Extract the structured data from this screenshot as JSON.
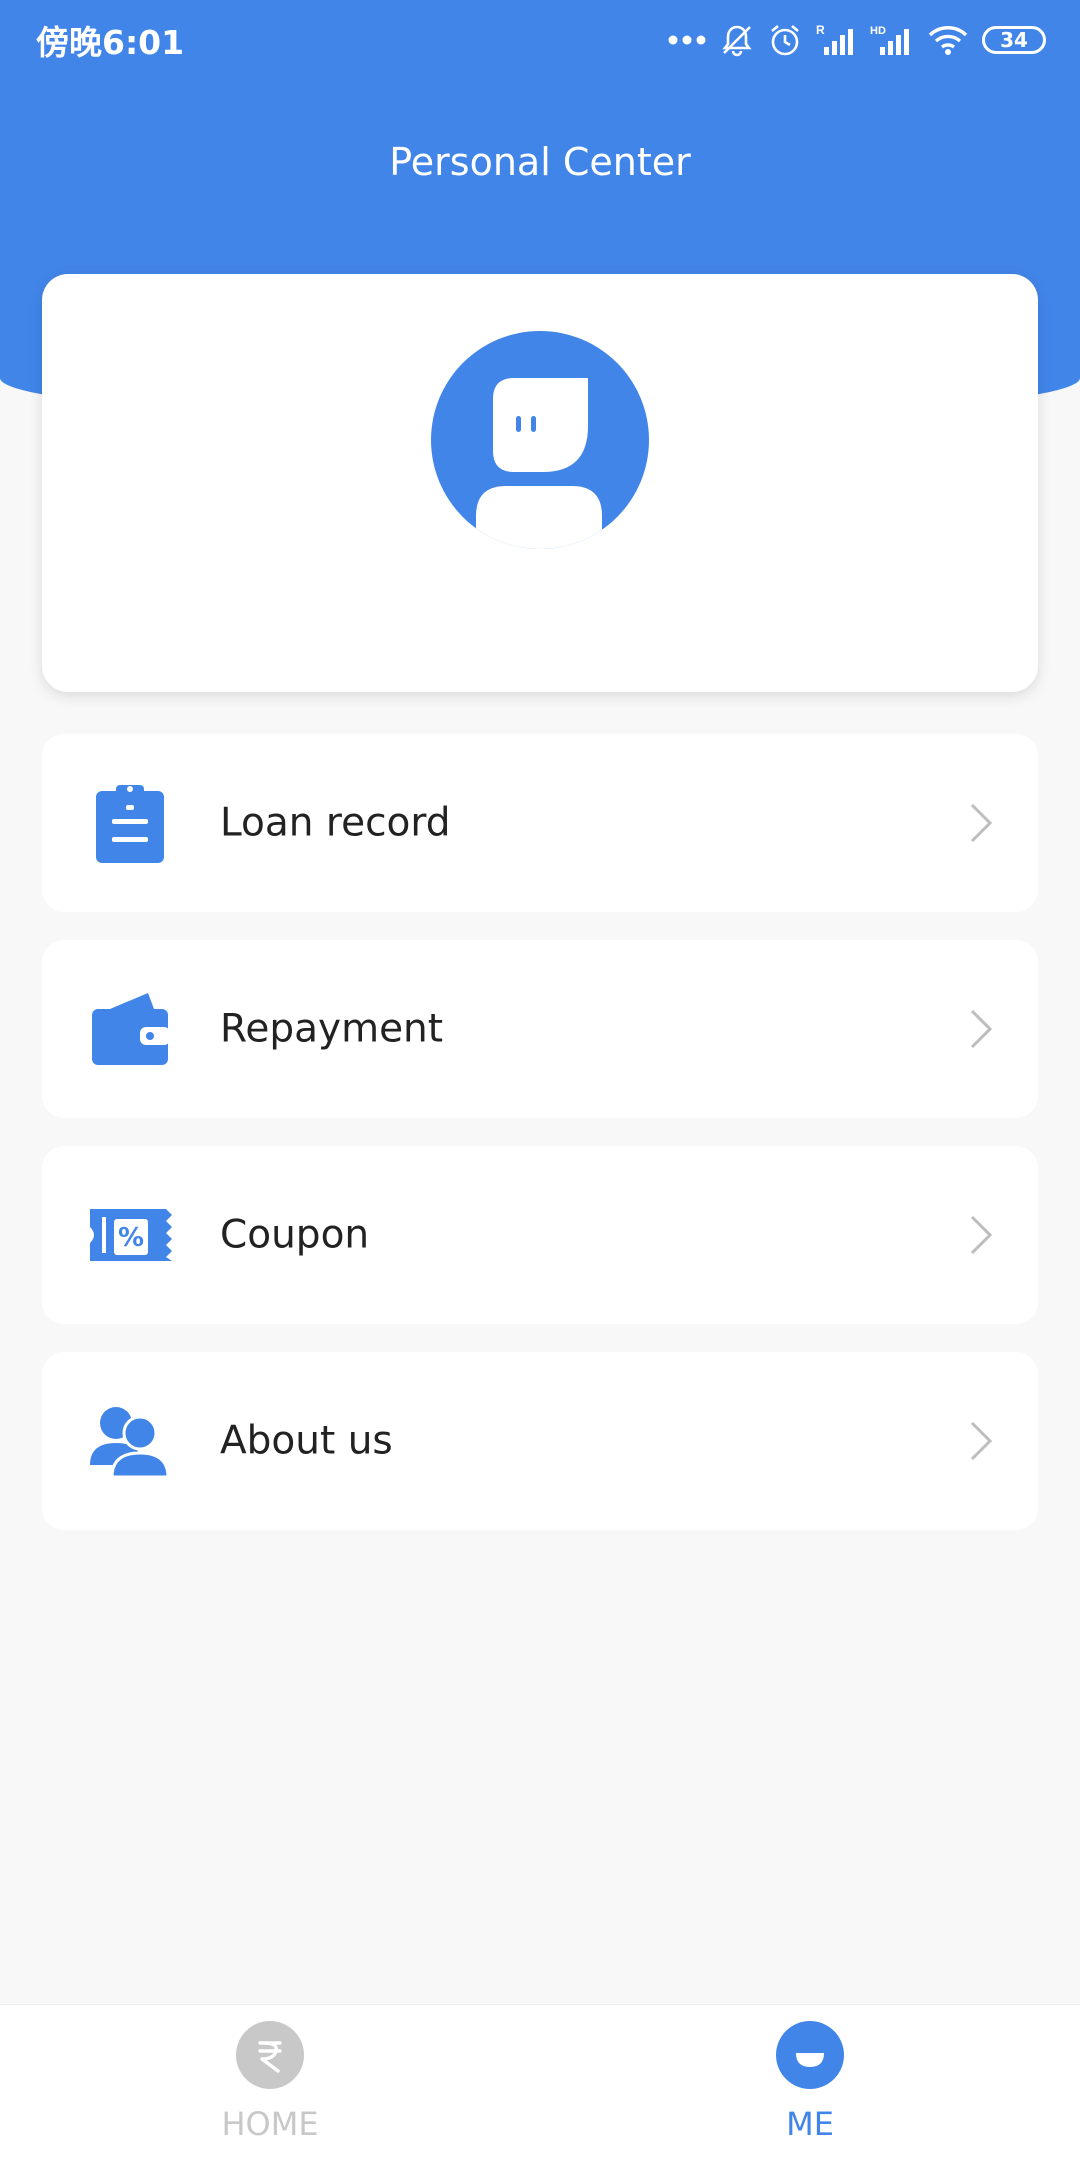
{
  "status_bar": {
    "time": "傍晚6:01",
    "battery": "34",
    "icons": [
      "more-dots-icon",
      "mute-bell-icon",
      "alarm-icon",
      "signal-r-icon",
      "signal-hd-icon",
      "wifi-icon",
      "battery-icon"
    ]
  },
  "header": {
    "title": "Personal Center"
  },
  "profile": {
    "avatar_icon": "avatar-icon"
  },
  "menu": {
    "items": [
      {
        "label": "Loan record",
        "icon": "clipboard-icon"
      },
      {
        "label": "Repayment",
        "icon": "wallet-icon"
      },
      {
        "label": "Coupon",
        "icon": "coupon-icon"
      },
      {
        "label": "About us",
        "icon": "users-icon"
      }
    ]
  },
  "bottom_nav": {
    "tabs": [
      {
        "label": "HOME",
        "icon": "rupee-icon",
        "active": false
      },
      {
        "label": "ME",
        "icon": "me-icon",
        "active": true
      }
    ]
  },
  "colors": {
    "primary": "#4285e9",
    "background": "#f8f8f8",
    "inactive": "#c8c8c8"
  }
}
